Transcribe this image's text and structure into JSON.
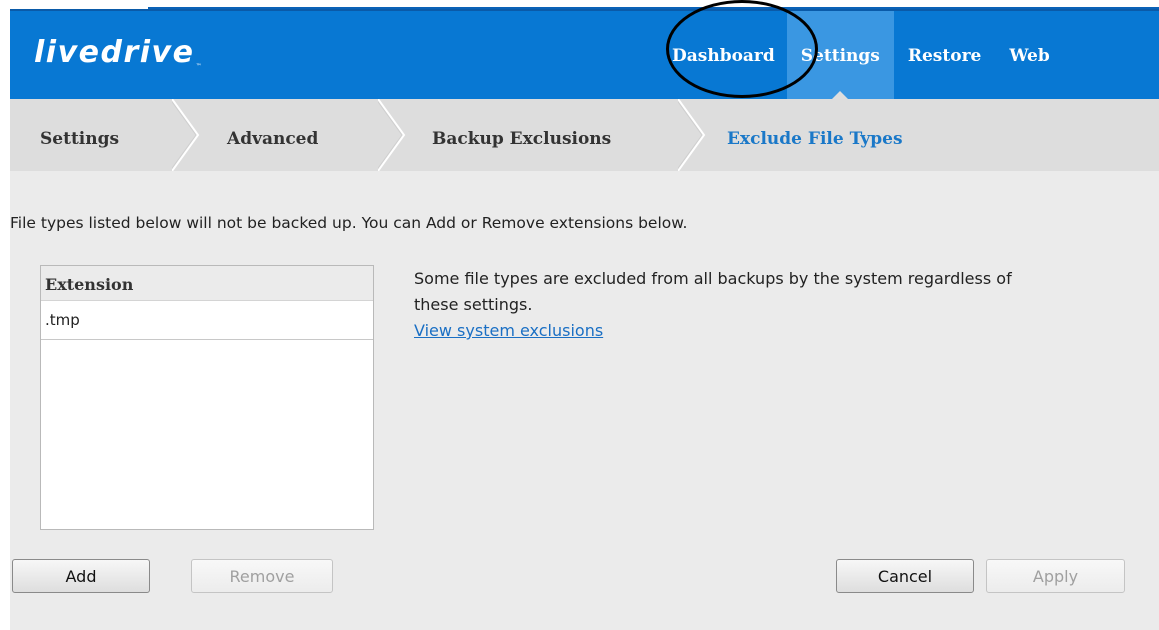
{
  "app": {
    "logo_text": "livedrive",
    "logo_tm": "™"
  },
  "nav": {
    "items": [
      {
        "label": "Dashboard",
        "active": false
      },
      {
        "label": "Settings",
        "active": true
      },
      {
        "label": "Restore",
        "active": false
      },
      {
        "label": "Web",
        "active": false
      }
    ]
  },
  "breadcrumb": {
    "items": [
      {
        "label": "Settings",
        "active": false
      },
      {
        "label": "Advanced",
        "active": false
      },
      {
        "label": "Backup Exclusions",
        "active": false
      },
      {
        "label": "Exclude File Types",
        "active": true
      }
    ]
  },
  "main": {
    "description": "File types listed below will not be backed up. You can Add or Remove extensions below.",
    "list": {
      "header": "Extension",
      "rows": [
        ".tmp"
      ]
    },
    "info_text": "Some file types are excluded from all backups by the system regardless of these settings.",
    "info_link": "View system exclusions"
  },
  "buttons": {
    "add": "Add",
    "remove": "Remove",
    "cancel": "Cancel",
    "apply": "Apply"
  },
  "colors": {
    "header_blue": "#0878d3",
    "active_tab": "#3a97e2",
    "active_crumb": "#1a78c8",
    "annotation_circle": "#000000"
  }
}
